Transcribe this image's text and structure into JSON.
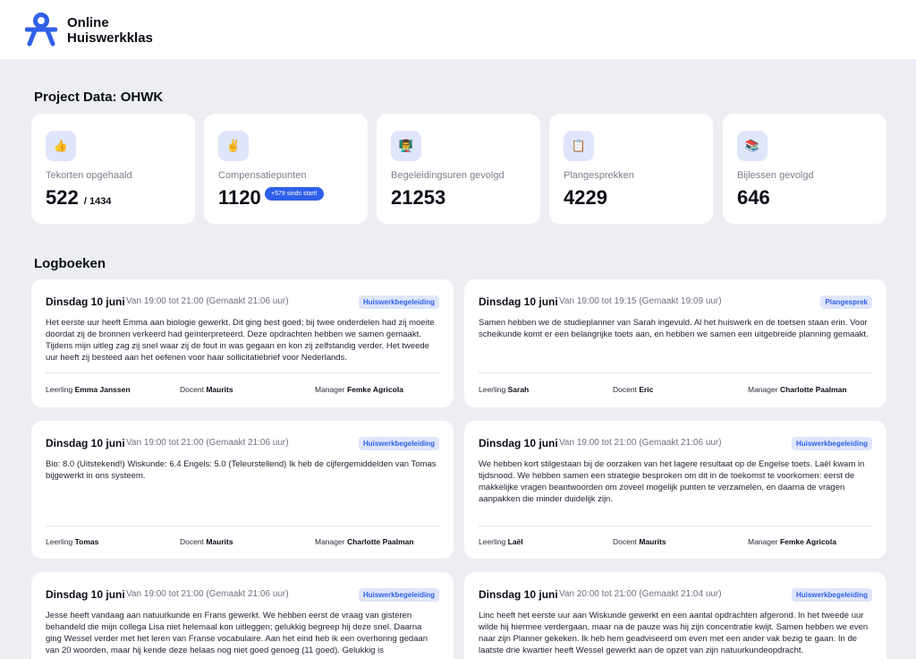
{
  "brand": {
    "line1": "Online",
    "line2": "Huiswerkklas"
  },
  "project_title": "Project Data: OHWK",
  "stats": [
    {
      "icon": "thumbs-up-icon",
      "emoji": "👍",
      "label": "Tekorten opgehaald",
      "value": "522",
      "total": "/ 1434"
    },
    {
      "icon": "victory-hand-icon",
      "emoji": "✌",
      "label": "Compensatiepunten",
      "value": "1120",
      "badge": "+579 sinds start!"
    },
    {
      "icon": "teacher-icon",
      "emoji": "👨‍🏫",
      "label": "Begeleidingsuren gevolgd",
      "value": "21253"
    },
    {
      "icon": "clipboard-icon",
      "emoji": "📋",
      "label": "Plangesprekken",
      "value": "4229"
    },
    {
      "icon": "books-icon",
      "emoji": "📚",
      "label": "Bijlessen gevolgd",
      "value": "646"
    }
  ],
  "logbooks_title": "Logboeken",
  "labels": {
    "student": "Leerling",
    "teacher": "Docent",
    "manager": "Manager"
  },
  "logs": [
    {
      "date": "Dinsdag 10 juni",
      "time": "Van 19:00 tot 21:00 (Gemaakt 21:06 uur)",
      "tag": "Huiswerkbegeleiding",
      "text": "Het eerste uur heeft Emma aan biologie gewerkt. Dit ging best goed; bij twee onderdelen had zij moeite doordat zij de bronnen verkeerd had geïnterpreteerd. Deze opdrachten hebben we samen gemaakt. Tijdens mijn uitleg zag zij snel waar zij de fout in was gegaan en kon zij zelfstandig verder. Het tweede uur heeft zij besteed aan het oefenen voor haar sollicitatiebrief voor Nederlands.",
      "student": "Emma Janssen",
      "teacher": "Maurits",
      "manager": "Femke Agricola"
    },
    {
      "date": "Dinsdag 10 juni",
      "time": "Van 19:00 tot 19:15 (Gemaakt 19:09 uur)",
      "tag": "Plangesprek",
      "text": "Samen hebben we de studieplanner van Sarah ingevuld. Al het huiswerk en de toetsen staan erin. Voor scheikunde komt er een belangrijke toets aan, en hebben we samen een uitgebreide planning gemaakt.",
      "student": "Sarah",
      "teacher": "Eric",
      "manager": "Charlotte Paalman"
    },
    {
      "date": "Dinsdag 10 juni",
      "time": "Van 19:00 tot 21:00 (Gemaakt 21:06 uur)",
      "tag": "Huiswerkbegeleiding",
      "text": "Bio: 8.0 (Uitstekend!) Wiskunde: 6.4 Engels: 5.0 (Teleurstellend) Ik heb de cijfergemiddelden van Tomas bijgewerkt in ons systeem.",
      "student": "Tomas",
      "teacher": "Maurits",
      "manager": "Charlotte Paalman"
    },
    {
      "date": "Dinsdag 10 juni",
      "time": "Van 19:00 tot 21:00 (Gemaakt 21:06 uur)",
      "tag": "Huiswerkbegeleiding",
      "text": "We hebben kort stilgestaan bij de oorzaken van het lagere resultaat op de Engelse toets. Laël kwam in tijdsnood. We hebben samen een strategie besproken om dit in de toekomst te voorkomen: eerst de makkelijke vragen beantwoorden om zoveel mogelijk punten te verzamelen, en daarna de vragen aanpakken die minder duidelijk zijn.",
      "student": "Laël",
      "teacher": "Maurits",
      "manager": "Femke Agricola"
    },
    {
      "date": "Dinsdag 10 juni",
      "time": "Van 19:00 tot 21:00 (Gemaakt 21:06 uur)",
      "tag": "Huiswerkbegeleiding",
      "text": "Jesse heeft vandaag aan natuurkunde en Frans gewerkt. We hebben eerst de vraag van gisteren behandeld die mijn collega Lisa niet helemaal kon uitleggen; gelukkig begreep hij deze snel. Daarna ging Wessel verder met het leren van Franse vocabulaire. Aan het eind heb ik een overhoring gedaan van 20 woorden, maar hij kende deze helaas nog niet goed genoeg (11 goed). Gelukkig is"
    },
    {
      "date": "Dinsdag 10 juni",
      "time": "Van 20:00 tot 21:00 (Gemaakt 21:04 uur)",
      "tag": "Huiswerkbegeleiding",
      "text": "Linc heeft het eerste uur aan Wiskunde gewerkt en een aantal opdrachten afgerond. In het tweede uur wilde hij hiermee verdergaan, maar na de pauze was hij zijn concentratie kwijt. Samen hebben we even naar zijn Planner gekeken. Ik heb hem geadviseerd om even met een ander vak bezig te gaan. In de laatste drie kwartier heeft Wessel gewerkt aan de opzet van zijn natuurkundeopdracht."
    }
  ]
}
